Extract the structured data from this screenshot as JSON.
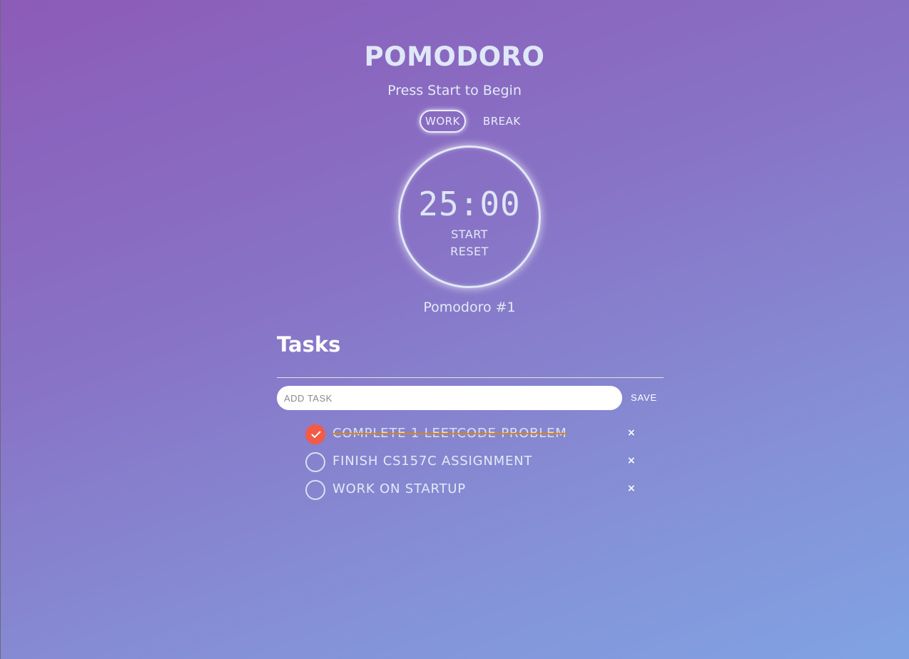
{
  "app": {
    "title": "POMODORO",
    "status": "Press Start to Begin"
  },
  "modes": {
    "work_label": "WORK",
    "break_label": "BREAK",
    "active": "WORK"
  },
  "timer": {
    "display": "25:00",
    "start_label": "START",
    "reset_label": "RESET"
  },
  "session": {
    "label": "Pomodoro #1"
  },
  "tasks": {
    "heading": "Tasks",
    "input_placeholder": "ADD TASK",
    "input_value": "",
    "save_label": "SAVE",
    "delete_icon": "×",
    "items": [
      {
        "text": "COMPLETE 1 LEETCODE PROBLEM",
        "done": true
      },
      {
        "text": "FINISH CS157C ASSIGNMENT",
        "done": false
      },
      {
        "text": "WORK ON STARTUP",
        "done": false
      }
    ]
  },
  "colors": {
    "background_start": "#8c5bb8",
    "background_end": "#80a3e3",
    "accent_done": "#f25b46",
    "strike": "#d4871f",
    "text": "#e3eaf6"
  }
}
